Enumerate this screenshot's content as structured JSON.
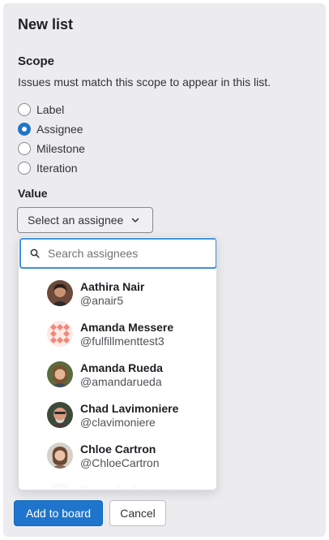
{
  "panel": {
    "title": "New list",
    "scope_heading": "Scope",
    "scope_description": "Issues must match this scope to appear in this list.",
    "scope_options": [
      {
        "label": "Label",
        "checked": false
      },
      {
        "label": "Assignee",
        "checked": true
      },
      {
        "label": "Milestone",
        "checked": false
      },
      {
        "label": "Iteration",
        "checked": false
      }
    ],
    "value_heading": "Value",
    "select_label": "Select an assignee"
  },
  "dropdown": {
    "search_placeholder": "Search assignees",
    "users": [
      {
        "name": "Aathira Nair",
        "handle": "@anair5",
        "avatar": "photo-avatar"
      },
      {
        "name": "Amanda Messere",
        "handle": "@fulfillmenttest3",
        "avatar": "identicon-avatar"
      },
      {
        "name": "Amanda Rueda",
        "handle": "@amandarueda",
        "avatar": "photo-avatar"
      },
      {
        "name": "Chad Lavimoniere",
        "handle": "@clavimoniere",
        "avatar": "photo-avatar"
      },
      {
        "name": "Chloe Cartron",
        "handle": "@ChloeCartron",
        "avatar": "photo-avatar"
      },
      {
        "name": "Davis Jochansson",
        "handle": "",
        "avatar": "photo-avatar"
      }
    ]
  },
  "actions": {
    "add_label": "Add to board",
    "cancel_label": "Cancel"
  },
  "colors": {
    "primary": "#1f75cb",
    "focus_ring": "#428fdc",
    "panel_bg": "#ececef"
  }
}
